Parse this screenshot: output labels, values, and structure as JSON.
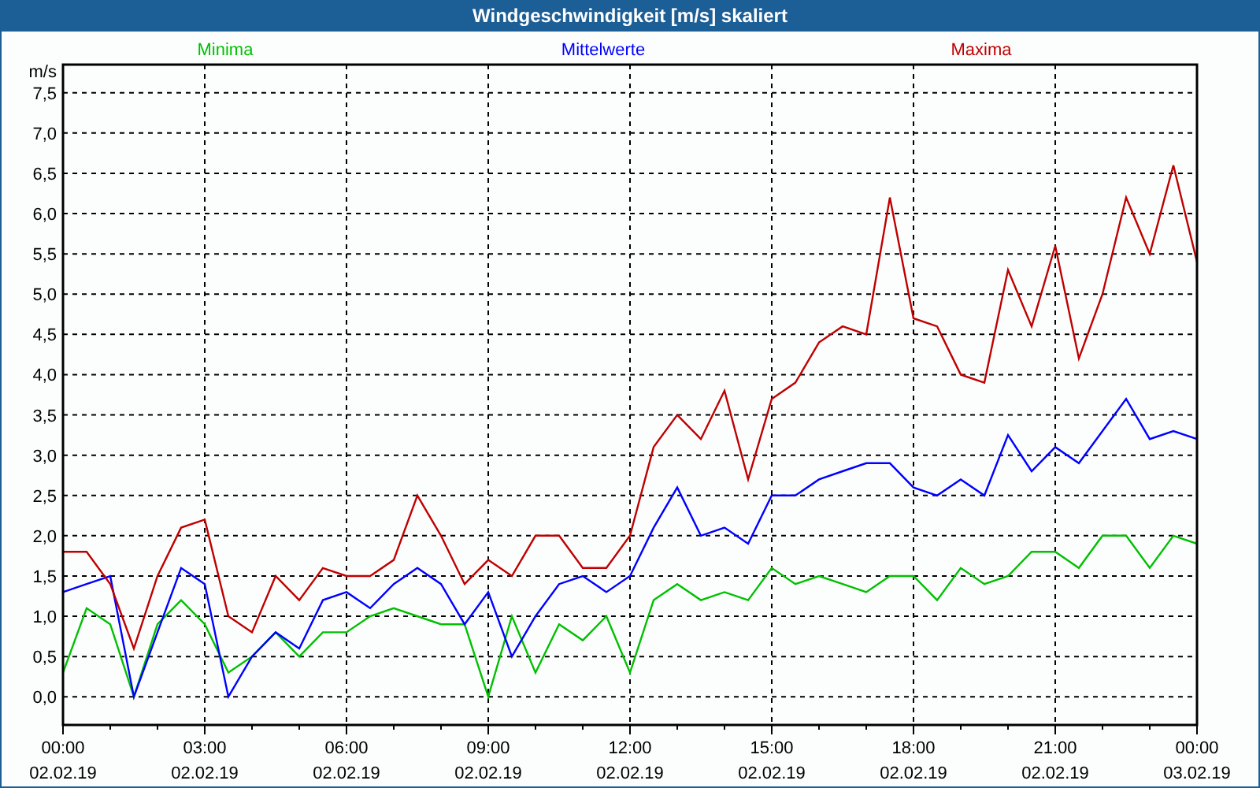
{
  "window": {
    "title": "Windgeschwindigkeit [m/s] skaliert"
  },
  "chart": {
    "chart_data": {
      "type": "line",
      "ylabel": "m/s",
      "categories": [
        "00:00\n02.02.19",
        null,
        null,
        null,
        null,
        null,
        "03:00\n02.02.19",
        null,
        null,
        null,
        null,
        null,
        "06:00\n02.02.19",
        null,
        null,
        null,
        null,
        null,
        "09:00\n02.02.19",
        null,
        null,
        null,
        null,
        null,
        "12:00\n02.02.19",
        null,
        null,
        null,
        null,
        null,
        "15:00\n02.02.19",
        null,
        null,
        null,
        null,
        null,
        "18:00\n02.02.19",
        null,
        null,
        null,
        null,
        null,
        "21:00\n02.02.19",
        null,
        null,
        null,
        null,
        null,
        "00:00\n03.02.19"
      ],
      "series": [
        {
          "name": "Minima",
          "color": "#00c000",
          "values": [
            0.3,
            1.1,
            0.9,
            0.0,
            0.9,
            1.2,
            0.9,
            0.3,
            0.5,
            0.8,
            0.5,
            0.8,
            0.8,
            1.0,
            1.1,
            1.0,
            0.9,
            0.9,
            0.0,
            1.0,
            0.3,
            0.9,
            0.7,
            1.0,
            0.3,
            1.2,
            1.4,
            1.2,
            1.3,
            1.2,
            1.6,
            1.4,
            1.5,
            1.4,
            1.3,
            1.5,
            1.5,
            1.2,
            1.6,
            1.4,
            1.5,
            1.8,
            1.8,
            1.6,
            2.0,
            2.0,
            1.6,
            2.0,
            1.9
          ]
        },
        {
          "name": "Mittelwerte",
          "color": "#0000ff",
          "values": [
            1.3,
            1.4,
            1.5,
            0.0,
            0.8,
            1.6,
            1.4,
            0.0,
            0.5,
            0.8,
            0.6,
            1.2,
            1.3,
            1.1,
            1.4,
            1.6,
            1.4,
            0.9,
            1.3,
            0.5,
            1.0,
            1.4,
            1.5,
            1.3,
            1.5,
            2.1,
            2.6,
            2.0,
            2.1,
            1.9,
            2.5,
            2.5,
            2.7,
            2.8,
            2.9,
            2.9,
            2.6,
            2.5,
            2.7,
            2.5,
            3.25,
            2.8,
            3.1,
            2.9,
            3.3,
            3.7,
            3.2,
            3.3,
            3.2
          ]
        },
        {
          "name": "Maxima",
          "color": "#c00000",
          "values": [
            1.8,
            1.8,
            1.4,
            0.6,
            1.5,
            2.1,
            2.2,
            1.0,
            0.8,
            1.5,
            1.2,
            1.6,
            1.5,
            1.5,
            1.7,
            2.5,
            2.0,
            1.4,
            1.7,
            1.5,
            2.0,
            2.0,
            1.6,
            1.6,
            2.0,
            3.1,
            3.5,
            3.2,
            3.8,
            2.7,
            3.7,
            3.9,
            4.4,
            4.6,
            4.5,
            6.2,
            4.7,
            4.6,
            4.0,
            3.9,
            5.3,
            4.6,
            5.6,
            4.2,
            5.0,
            6.2,
            5.5,
            6.6,
            5.4
          ]
        }
      ],
      "ylim": [
        -0.35,
        7.85
      ],
      "grid": true,
      "yticks": [
        {
          "value": 0,
          "label": "0,0"
        },
        {
          "value": 0.5,
          "label": "0,5"
        },
        {
          "value": 1,
          "label": "1,0"
        },
        {
          "value": 1.5,
          "label": "1,5"
        },
        {
          "value": 2,
          "label": "2,0"
        },
        {
          "value": 2.5,
          "label": "2,5"
        },
        {
          "value": 3,
          "label": "3,0"
        },
        {
          "value": 3.5,
          "label": "3,5"
        },
        {
          "value": 4,
          "label": "4,0"
        },
        {
          "value": 4.5,
          "label": "4,5"
        },
        {
          "value": 5,
          "label": "5,0"
        },
        {
          "value": 5.5,
          "label": "5,5"
        },
        {
          "value": 6,
          "label": "6,0"
        },
        {
          "value": 6.5,
          "label": "6,5"
        },
        {
          "value": 7,
          "label": "7,0"
        },
        {
          "value": 7.5,
          "label": "7,5"
        }
      ]
    }
  }
}
